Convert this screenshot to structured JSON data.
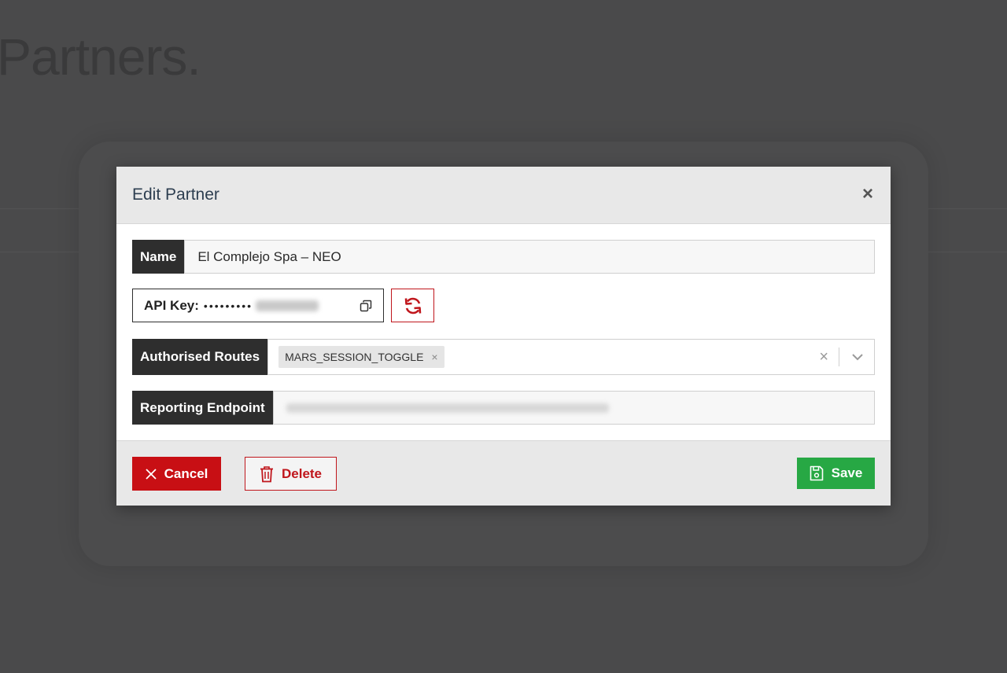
{
  "background": {
    "title": "Partners."
  },
  "modal": {
    "title": "Edit Partner",
    "close_glyph": "×",
    "fields": {
      "name_label": "Name",
      "name_value": "El Complejo Spa – NEO",
      "api_key_label": "API Key:",
      "api_key_masked": "•••••••••",
      "routes_label": "Authorised Routes",
      "routes": [
        {
          "label": "MARS_SESSION_TOGGLE",
          "remove": "×"
        }
      ],
      "routes_clear": "×",
      "endpoint_label": "Reporting Endpoint"
    },
    "footer": {
      "cancel_label": "Cancel",
      "delete_label": "Delete",
      "save_label": "Save"
    }
  },
  "colors": {
    "overlay": "#4a4a4b",
    "danger": "#c80f14",
    "success": "#27a844",
    "label_bg": "#2e2e2e"
  },
  "icons": {
    "close": "close-icon",
    "copy": "copy-icon",
    "refresh": "refresh-icon",
    "clear": "clear-icon",
    "chevron": "chevron-down-icon",
    "cancel": "x-icon",
    "delete": "trash-icon",
    "save": "floppy-icon"
  }
}
